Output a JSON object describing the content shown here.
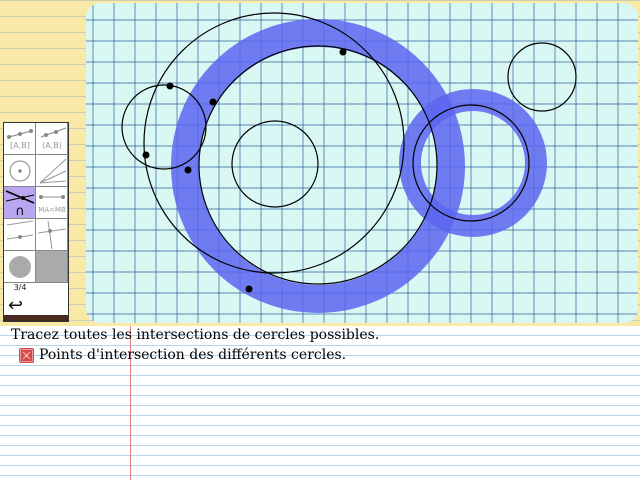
{
  "toolbar": {
    "tools": [
      {
        "name": "segment-tool",
        "label": ""
      },
      {
        "name": "ray-tool",
        "label": ""
      },
      {
        "name": "segment-ab-tool",
        "label": "[A,B]"
      },
      {
        "name": "line-ab-tool",
        "label": "(A,B)"
      },
      {
        "name": "circle-tool",
        "label": ""
      },
      {
        "name": "angle-tool",
        "label": ""
      },
      {
        "name": "intersection-tool",
        "label": "∩",
        "active": true
      },
      {
        "name": "equidistant-tool",
        "label": "MA=MB"
      },
      {
        "name": "parallel-tool",
        "label": ""
      },
      {
        "name": "perpendicular-tool",
        "label": ""
      },
      {
        "name": "point-tool",
        "label": ""
      },
      {
        "name": "fill-tool",
        "label": ""
      }
    ],
    "page_indicator": "3/4",
    "back_label": "↩"
  },
  "colors": {
    "page_background": "#f9e9a6",
    "canvas_background": "#d9f7f3",
    "grid_line": "#2f5f9a",
    "highlight": "#5c66f0",
    "active_tool": "#b9a5f0",
    "objective_icon": "#d04a4a"
  },
  "instructions": {
    "task": "Tracez toutes les intersections de cercles possibles.",
    "objective": {
      "label": "Points d'intersection des différents cercles.",
      "status_icon": "incomplete-icon"
    }
  }
}
